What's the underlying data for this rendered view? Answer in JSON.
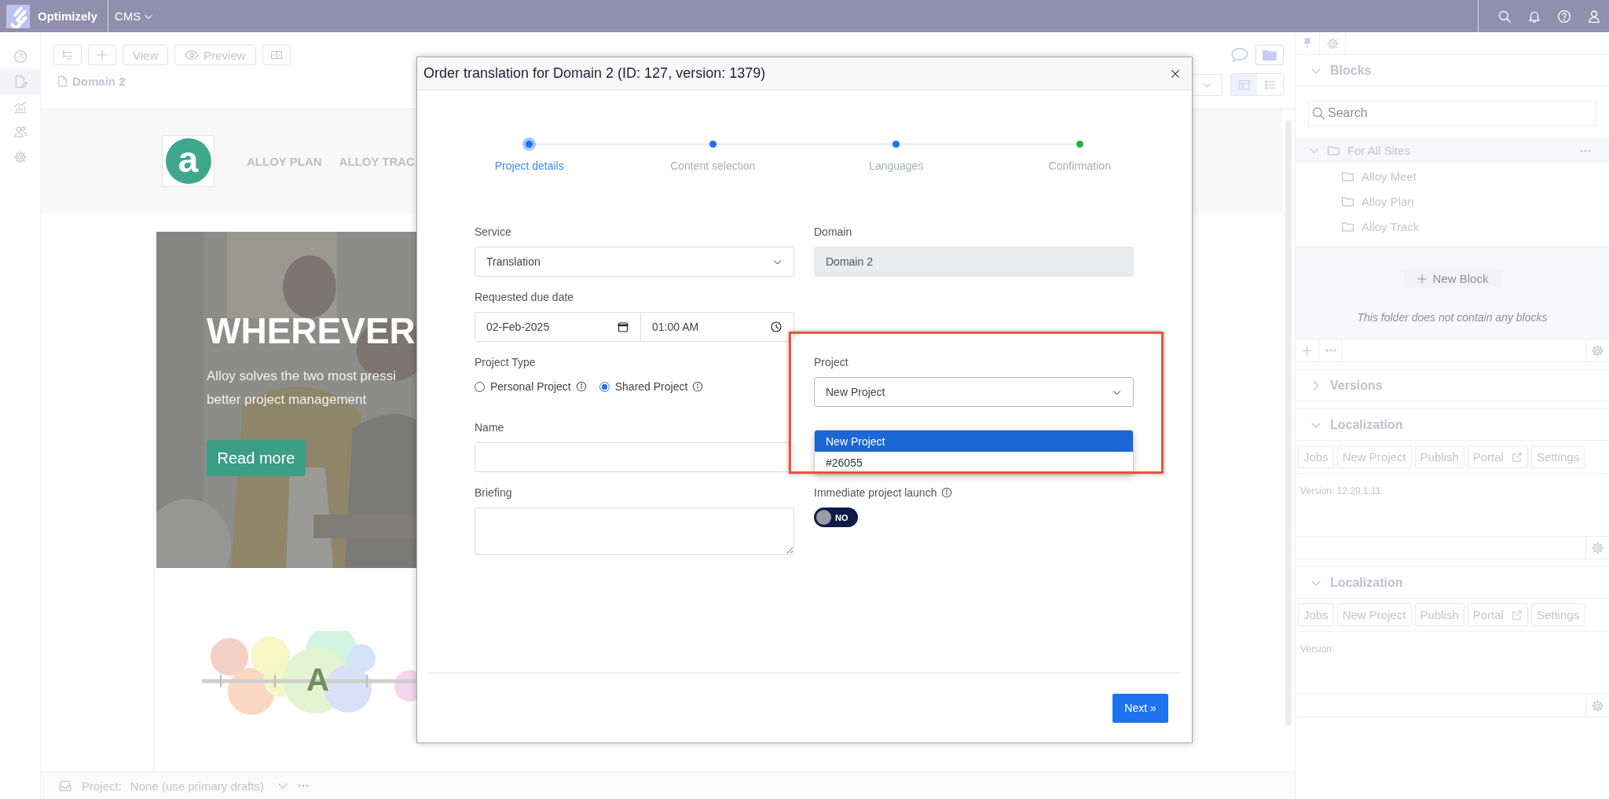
{
  "top_bar": {
    "brand": "Optimizely",
    "product": "CMS"
  },
  "nav_rail": [
    {
      "kind": "dashboard",
      "selected": false
    },
    {
      "kind": "edit",
      "selected": true
    },
    {
      "kind": "reports",
      "selected": false
    },
    {
      "kind": "users",
      "selected": false
    },
    {
      "kind": "settings",
      "selected": false
    }
  ],
  "toolbar": {
    "view_button": "View",
    "preview_button": "Preview"
  },
  "breadcrumb": "Domain 2",
  "preview_page": {
    "logo": "a",
    "nav": [
      "ALLOY PLAN",
      "ALLOY TRAC"
    ],
    "hero": {
      "kind": "picture",
      "heading": "WHEREVER",
      "text_lines": [
        "Alloy solves the two most pressi",
        "better project management"
      ],
      "button": "Read more"
    },
    "illustration_letter": "A"
  },
  "bottom_bar": {
    "label": "Project:",
    "value": "None (use primary drafts)"
  },
  "right_panel": {
    "blocks": {
      "title": "Blocks",
      "expanded": true,
      "search_placeholder": "Search",
      "tree": [
        {
          "label": "For All Sites",
          "expanded": true,
          "children": [
            {
              "label": "Alloy Meet"
            },
            {
              "label": "Alloy Plan"
            },
            {
              "label": "Alloy Track"
            }
          ]
        }
      ],
      "new_block": "New Block",
      "empty_text": "This folder does not contain any blocks"
    },
    "sections": [
      {
        "title": "Versions",
        "expanded": false
      },
      {
        "title": "Localization",
        "expanded": true,
        "buttons": [
          {
            "label": "Jobs",
            "external": false
          },
          {
            "label": "New Project",
            "external": false
          },
          {
            "label": "Publish",
            "external": false
          },
          {
            "label": "Portal",
            "external": true
          },
          {
            "label": "Settings",
            "external": false
          }
        ],
        "version": "Version: 12.29.1.11"
      },
      {
        "title": "Localization",
        "expanded": true,
        "buttons": [
          {
            "label": "Jobs",
            "external": false
          },
          {
            "label": "New Project",
            "external": false
          },
          {
            "label": "Publish",
            "external": false
          },
          {
            "label": "Portal",
            "external": true
          },
          {
            "label": "Settings",
            "external": false
          }
        ],
        "version": "Version:"
      }
    ]
  },
  "dialog": {
    "title": "Order translation for Domain 2 (ID: 127, version: 1379)",
    "steps": [
      {
        "label": "Project details",
        "selected": true,
        "color": "#1e73f0"
      },
      {
        "label": "Content selection",
        "selected": false,
        "color": "#1e73f0"
      },
      {
        "label": "Languages",
        "selected": false,
        "color": "#1e73f0"
      },
      {
        "label": "Confirmation",
        "selected": false,
        "color": "#1fb53a"
      }
    ],
    "service": {
      "label": "Service",
      "value": "Translation"
    },
    "domain": {
      "label": "Domain",
      "value": "Domain 2",
      "disabled": true
    },
    "due_date": {
      "label": "Requested due date",
      "date": "02-Feb-2025",
      "time": "01:00 AM"
    },
    "project_type": {
      "label": "Project Type",
      "options": [
        {
          "label": "Personal Project",
          "selected": false
        },
        {
          "label": "Shared Project",
          "selected": true
        }
      ]
    },
    "project": {
      "label": "Project",
      "value": "New Project",
      "expanded": true,
      "options": [
        {
          "label": "New Project",
          "selected": true
        },
        {
          "label": "#26055",
          "selected": false
        }
      ]
    },
    "name": {
      "label": "Name"
    },
    "briefing": {
      "label": "Briefing"
    },
    "immediate_launch": {
      "label": "Immediate project launch",
      "on": false,
      "text": "NO"
    },
    "next_button": "Next »"
  }
}
